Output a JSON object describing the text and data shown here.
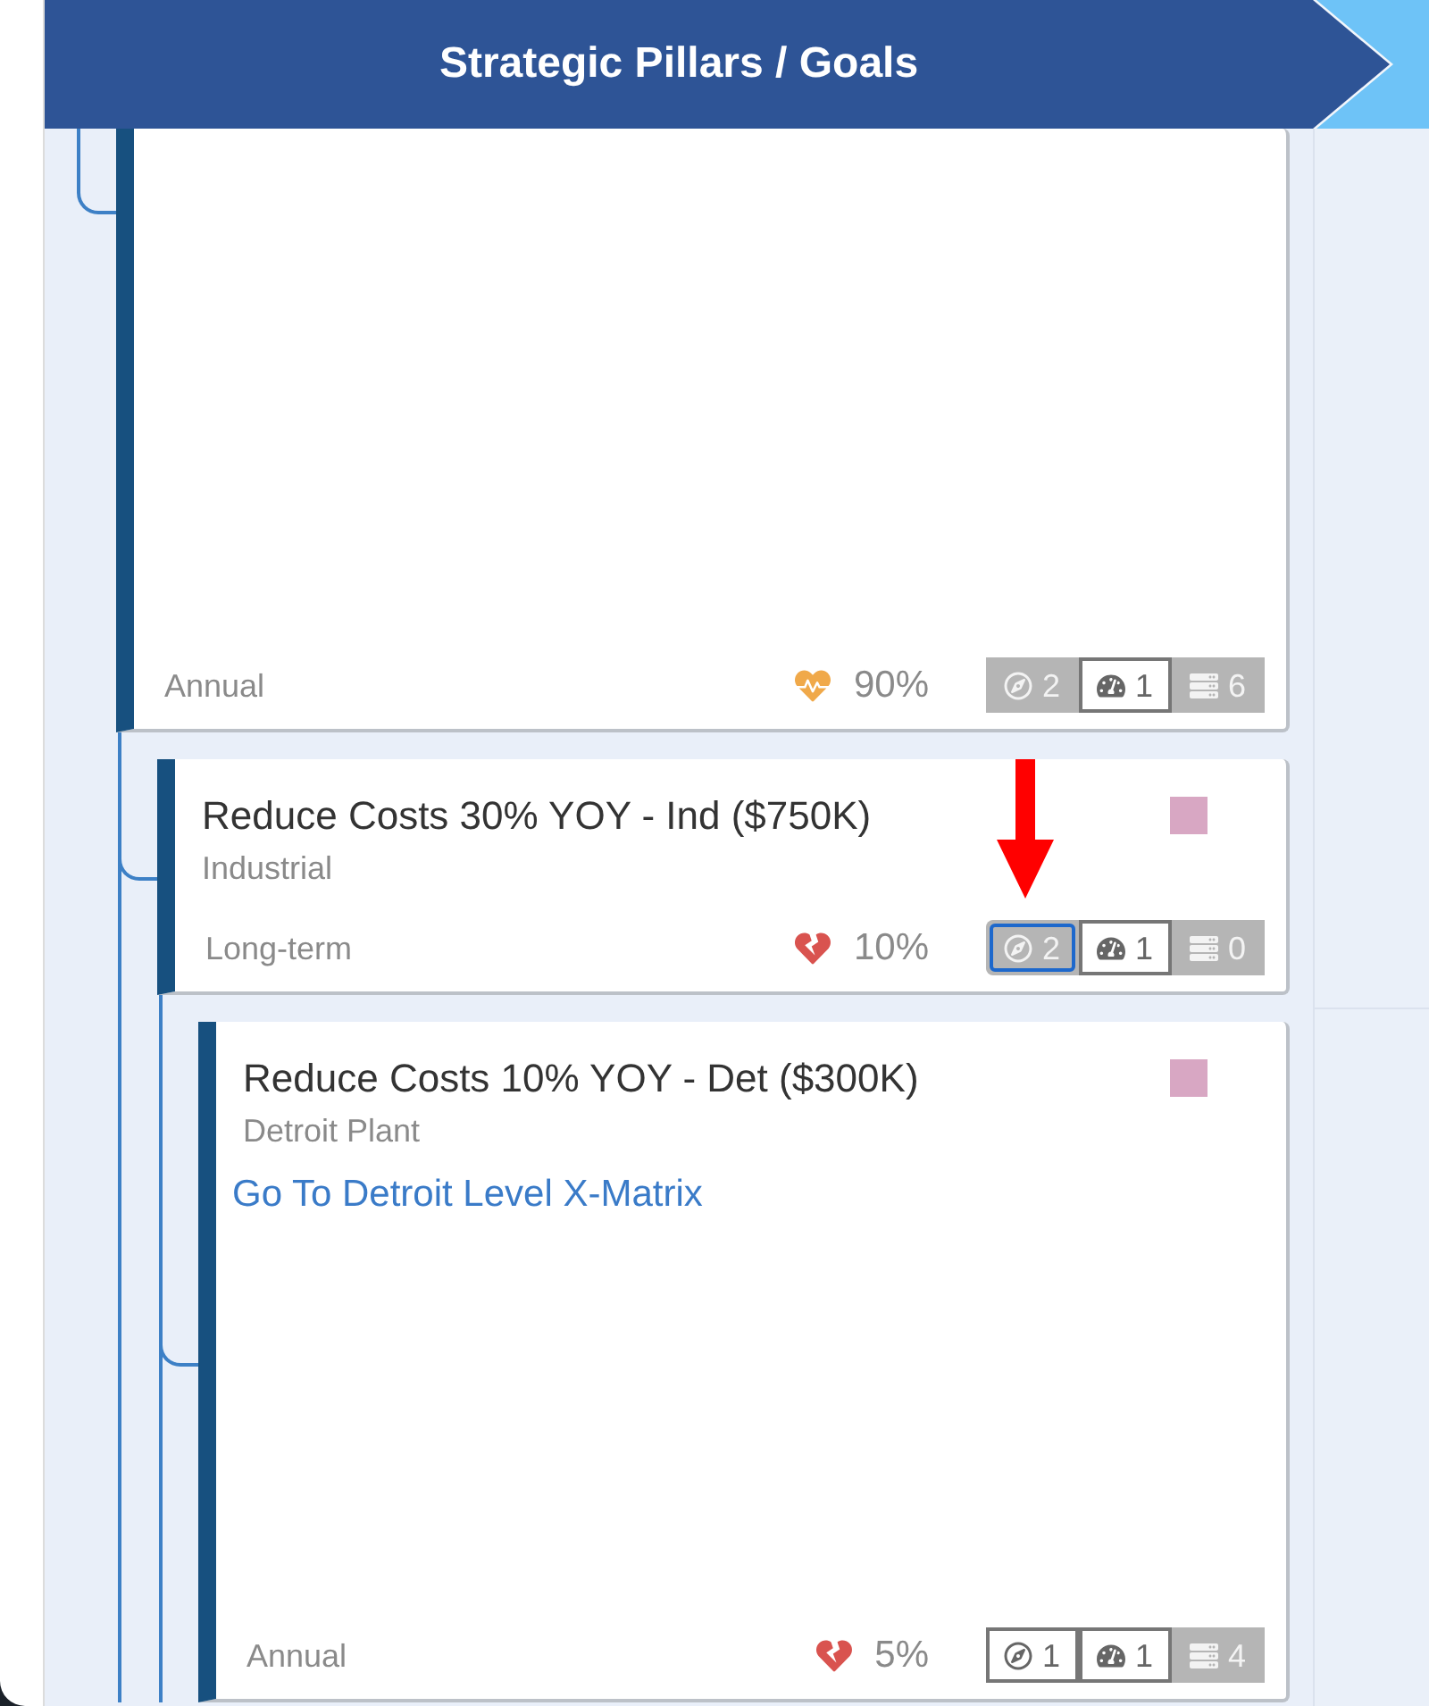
{
  "header": {
    "title": "Strategic Pillars / Goals"
  },
  "goals": [
    {
      "period": "Annual",
      "health": {
        "kind": "pulse",
        "reading": "90%"
      },
      "indicators": [
        {
          "kind": "compass",
          "count": "2",
          "active": false,
          "focused": false
        },
        {
          "kind": "gauge",
          "count": "1",
          "active": true,
          "focused": false
        },
        {
          "kind": "list",
          "count": "6",
          "active": false,
          "focused": false
        }
      ],
      "children": [
        {
          "title": "Reduce Costs 30% YOY - Ind ($750K)",
          "subtitle": "Industrial",
          "color": "#d8a7c3",
          "period": "Long-term",
          "health": {
            "kind": "broken",
            "reading": "10%"
          },
          "indicators": [
            {
              "kind": "compass",
              "count": "2",
              "active": false,
              "focused": true
            },
            {
              "kind": "gauge",
              "count": "1",
              "active": true,
              "focused": false
            },
            {
              "kind": "list",
              "count": "0",
              "active": false,
              "focused": false
            }
          ],
          "children": [
            {
              "title": "Reduce Costs 10% YOY - Det ($300K)",
              "subtitle": "Detroit Plant",
              "color": "#d8a7c3",
              "link": "Go To Detroit Level X-Matrix",
              "period": "Annual",
              "health": {
                "kind": "broken",
                "reading": "5%"
              },
              "indicators": [
                {
                  "kind": "compass",
                  "count": "1",
                  "active": true,
                  "focused": false
                },
                {
                  "kind": "gauge",
                  "count": "1",
                  "active": true,
                  "focused": false
                },
                {
                  "kind": "list",
                  "count": "4",
                  "active": false,
                  "focused": false
                }
              ]
            }
          ]
        }
      ]
    }
  ]
}
